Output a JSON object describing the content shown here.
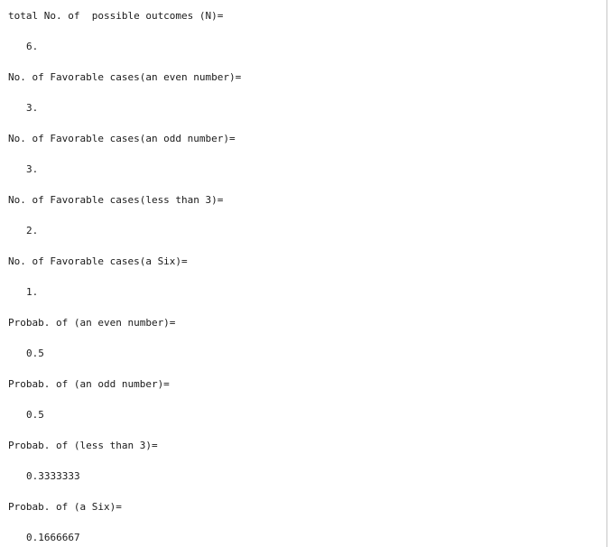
{
  "output": [
    {
      "label": "total No. of  possible outcomes (N)=",
      "value": "6."
    },
    {
      "label": "No. of Favorable cases(an even number)=",
      "value": "3."
    },
    {
      "label": "No. of Favorable cases(an odd number)=",
      "value": "3."
    },
    {
      "label": "No. of Favorable cases(less than 3)=",
      "value": "2."
    },
    {
      "label": "No. of Favorable cases(a Six)=",
      "value": "1."
    },
    {
      "label": "Probab. of (an even number)=",
      "value": "0.5"
    },
    {
      "label": "Probab. of (an odd number)=",
      "value": "0.5"
    },
    {
      "label": "Probab. of (less than 3)=",
      "value": "0.3333333"
    },
    {
      "label": "Probab. of (a Six)=",
      "value": "0.1666667"
    }
  ]
}
